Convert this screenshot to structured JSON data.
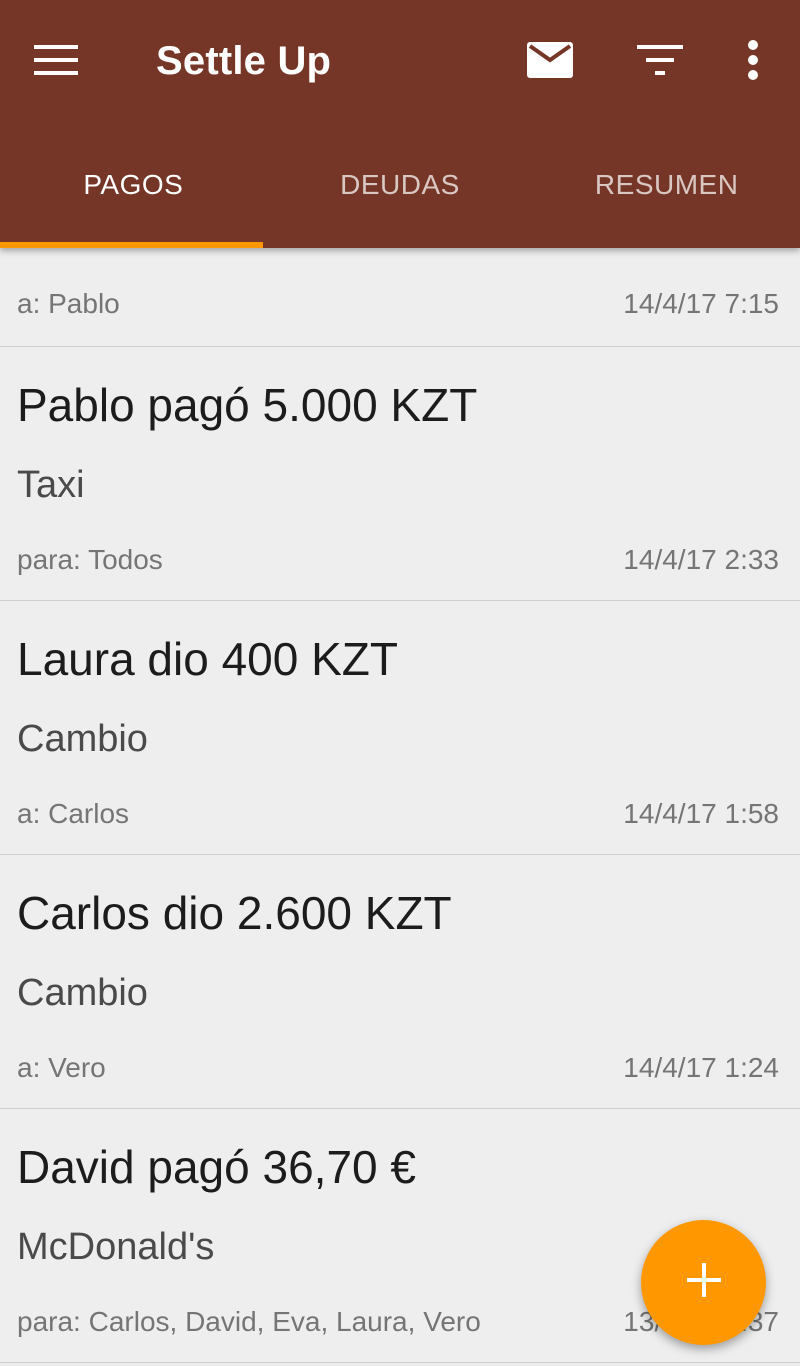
{
  "app": {
    "title": "Settle Up",
    "accent_color": "#763627",
    "fab_color": "#ff9800"
  },
  "toolbar": {
    "menu_icon": "hamburger-menu-icon",
    "actions": [
      "mail-icon",
      "filter-icon",
      "more-vert-icon"
    ]
  },
  "tabs": [
    {
      "label": "PAGOS",
      "active": true
    },
    {
      "label": "DEUDAS",
      "active": false
    },
    {
      "label": "RESUMEN",
      "active": false
    }
  ],
  "partial_item": {
    "meta": "a: Pablo",
    "date": "14/4/17 7:15"
  },
  "payments": [
    {
      "headline": "Pablo pagó 5.000 KZT",
      "description": "Taxi",
      "meta": "para: Todos",
      "date": "14/4/17 2:33"
    },
    {
      "headline": "Laura dio 400 KZT",
      "description": "Cambio",
      "meta": "a: Carlos",
      "date": "14/4/17 1:58"
    },
    {
      "headline": "Carlos dio 2.600 KZT",
      "description": "Cambio",
      "meta": "a: Vero",
      "date": "14/4/17 1:24"
    },
    {
      "headline": "David pagó 36,70 €",
      "description": "McDonald's",
      "meta": "para: Carlos, David, Eva, Laura, Vero",
      "date": "13/4/17 7:37"
    }
  ],
  "fab": {
    "icon": "add-icon"
  }
}
